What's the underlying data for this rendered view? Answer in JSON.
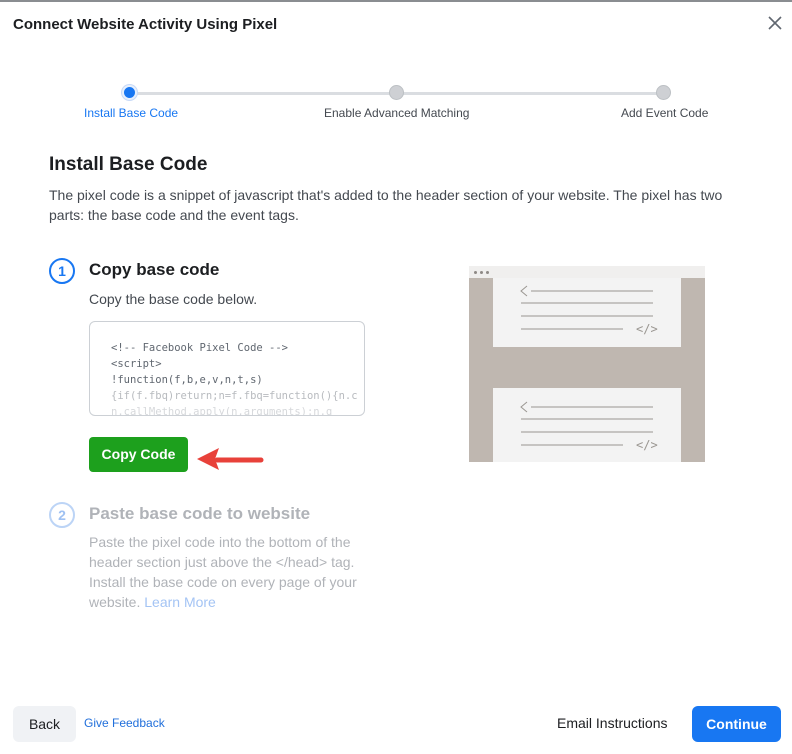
{
  "dialog": {
    "title": "Connect Website Activity Using Pixel"
  },
  "stepper": {
    "steps": [
      {
        "label": "Install Base Code",
        "state": "active"
      },
      {
        "label": "Enable Advanced Matching",
        "state": "inactive"
      },
      {
        "label": "Add Event Code",
        "state": "inactive"
      }
    ]
  },
  "section": {
    "title": "Install Base Code",
    "description": "The pixel code is a snippet of javascript that's added to the header section of your website. The pixel has two parts: the base code and the event tags."
  },
  "step1": {
    "number": "1",
    "title": "Copy base code",
    "description": "Copy the base code below.",
    "code_lines": [
      "<!-- Facebook Pixel Code -->",
      "<script>",
      "!function(f,b,e,v,n,t,s)",
      "{if(f.fbq)return;n=f.fbq=function(){n.c",
      "n.callMethod.apply(n,arguments):n.q"
    ],
    "copy_button": "Copy Code"
  },
  "step2": {
    "number": "2",
    "title": "Paste base code to website",
    "description": "Paste the pixel code into the bottom of the header section just above the </head> tag. Install the base code on every page of your website.",
    "learn_more": "Learn More"
  },
  "illustration": {
    "code_glyph": "</>"
  },
  "footer": {
    "back": "Back",
    "feedback": "Give Feedback",
    "email": "Email Instructions",
    "continue": "Continue"
  },
  "colors": {
    "accent": "#1877f2",
    "copy_button": "#1da01d",
    "arrow": "#e8413a"
  }
}
